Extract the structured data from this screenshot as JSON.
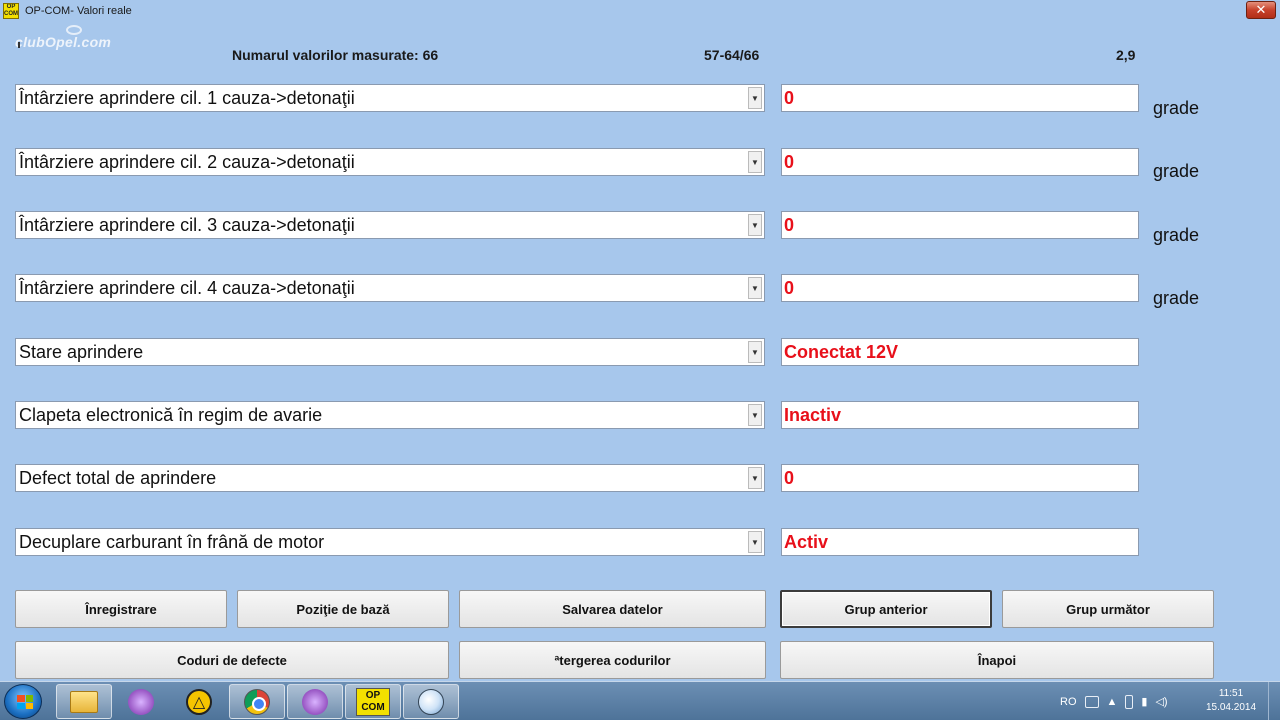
{
  "window": {
    "icon_text_top": "OP",
    "icon_text_bottom": "COM",
    "title": "OP-COM- Valori reale",
    "close_symbol": "✕"
  },
  "watermark": "clubOpel.com",
  "header": {
    "measured_count": "Numarul valorilor masurate: 66",
    "range": "57-64/66",
    "time": "2,9"
  },
  "rows": [
    {
      "parameter": "Întârziere aprindere cil. 1 cauza->detonaţii",
      "value": "0",
      "unit": "grade"
    },
    {
      "parameter": "Întârziere aprindere cil. 2 cauza->detonaţii",
      "value": "0",
      "unit": "grade"
    },
    {
      "parameter": "Întârziere aprindere cil. 3 cauza->detonaţii",
      "value": "0",
      "unit": "grade"
    },
    {
      "parameter": "Întârziere aprindere cil. 4 cauza->detonaţii",
      "value": "0",
      "unit": "grade"
    },
    {
      "parameter": "Stare aprindere",
      "value": "Conectat 12V",
      "unit": ""
    },
    {
      "parameter": "Clapeta electronică în regim de avarie",
      "value": "Inactiv",
      "unit": ""
    },
    {
      "parameter": "Defect total de aprindere",
      "value": "0",
      "unit": ""
    },
    {
      "parameter": "Decuplare carburant în frână de motor",
      "value": "Activ",
      "unit": ""
    }
  ],
  "buttons": {
    "record": "Înregistrare",
    "base_position": "Poziţie de bază",
    "save_data": "Salvarea datelor",
    "previous_group": "Grup anterior",
    "next_group": "Grup următor",
    "fault_codes": "Coduri de defecte",
    "clear_codes": "ªtergerea codurilor",
    "back": "Înapoi"
  },
  "taskbar": {
    "opcom_top": "OP",
    "opcom_bottom": "COM",
    "language": "RO",
    "time": "11:51",
    "date": "15.04.2014"
  },
  "colors": {
    "background": "#a7c7ec",
    "value_text": "#e8101a"
  }
}
